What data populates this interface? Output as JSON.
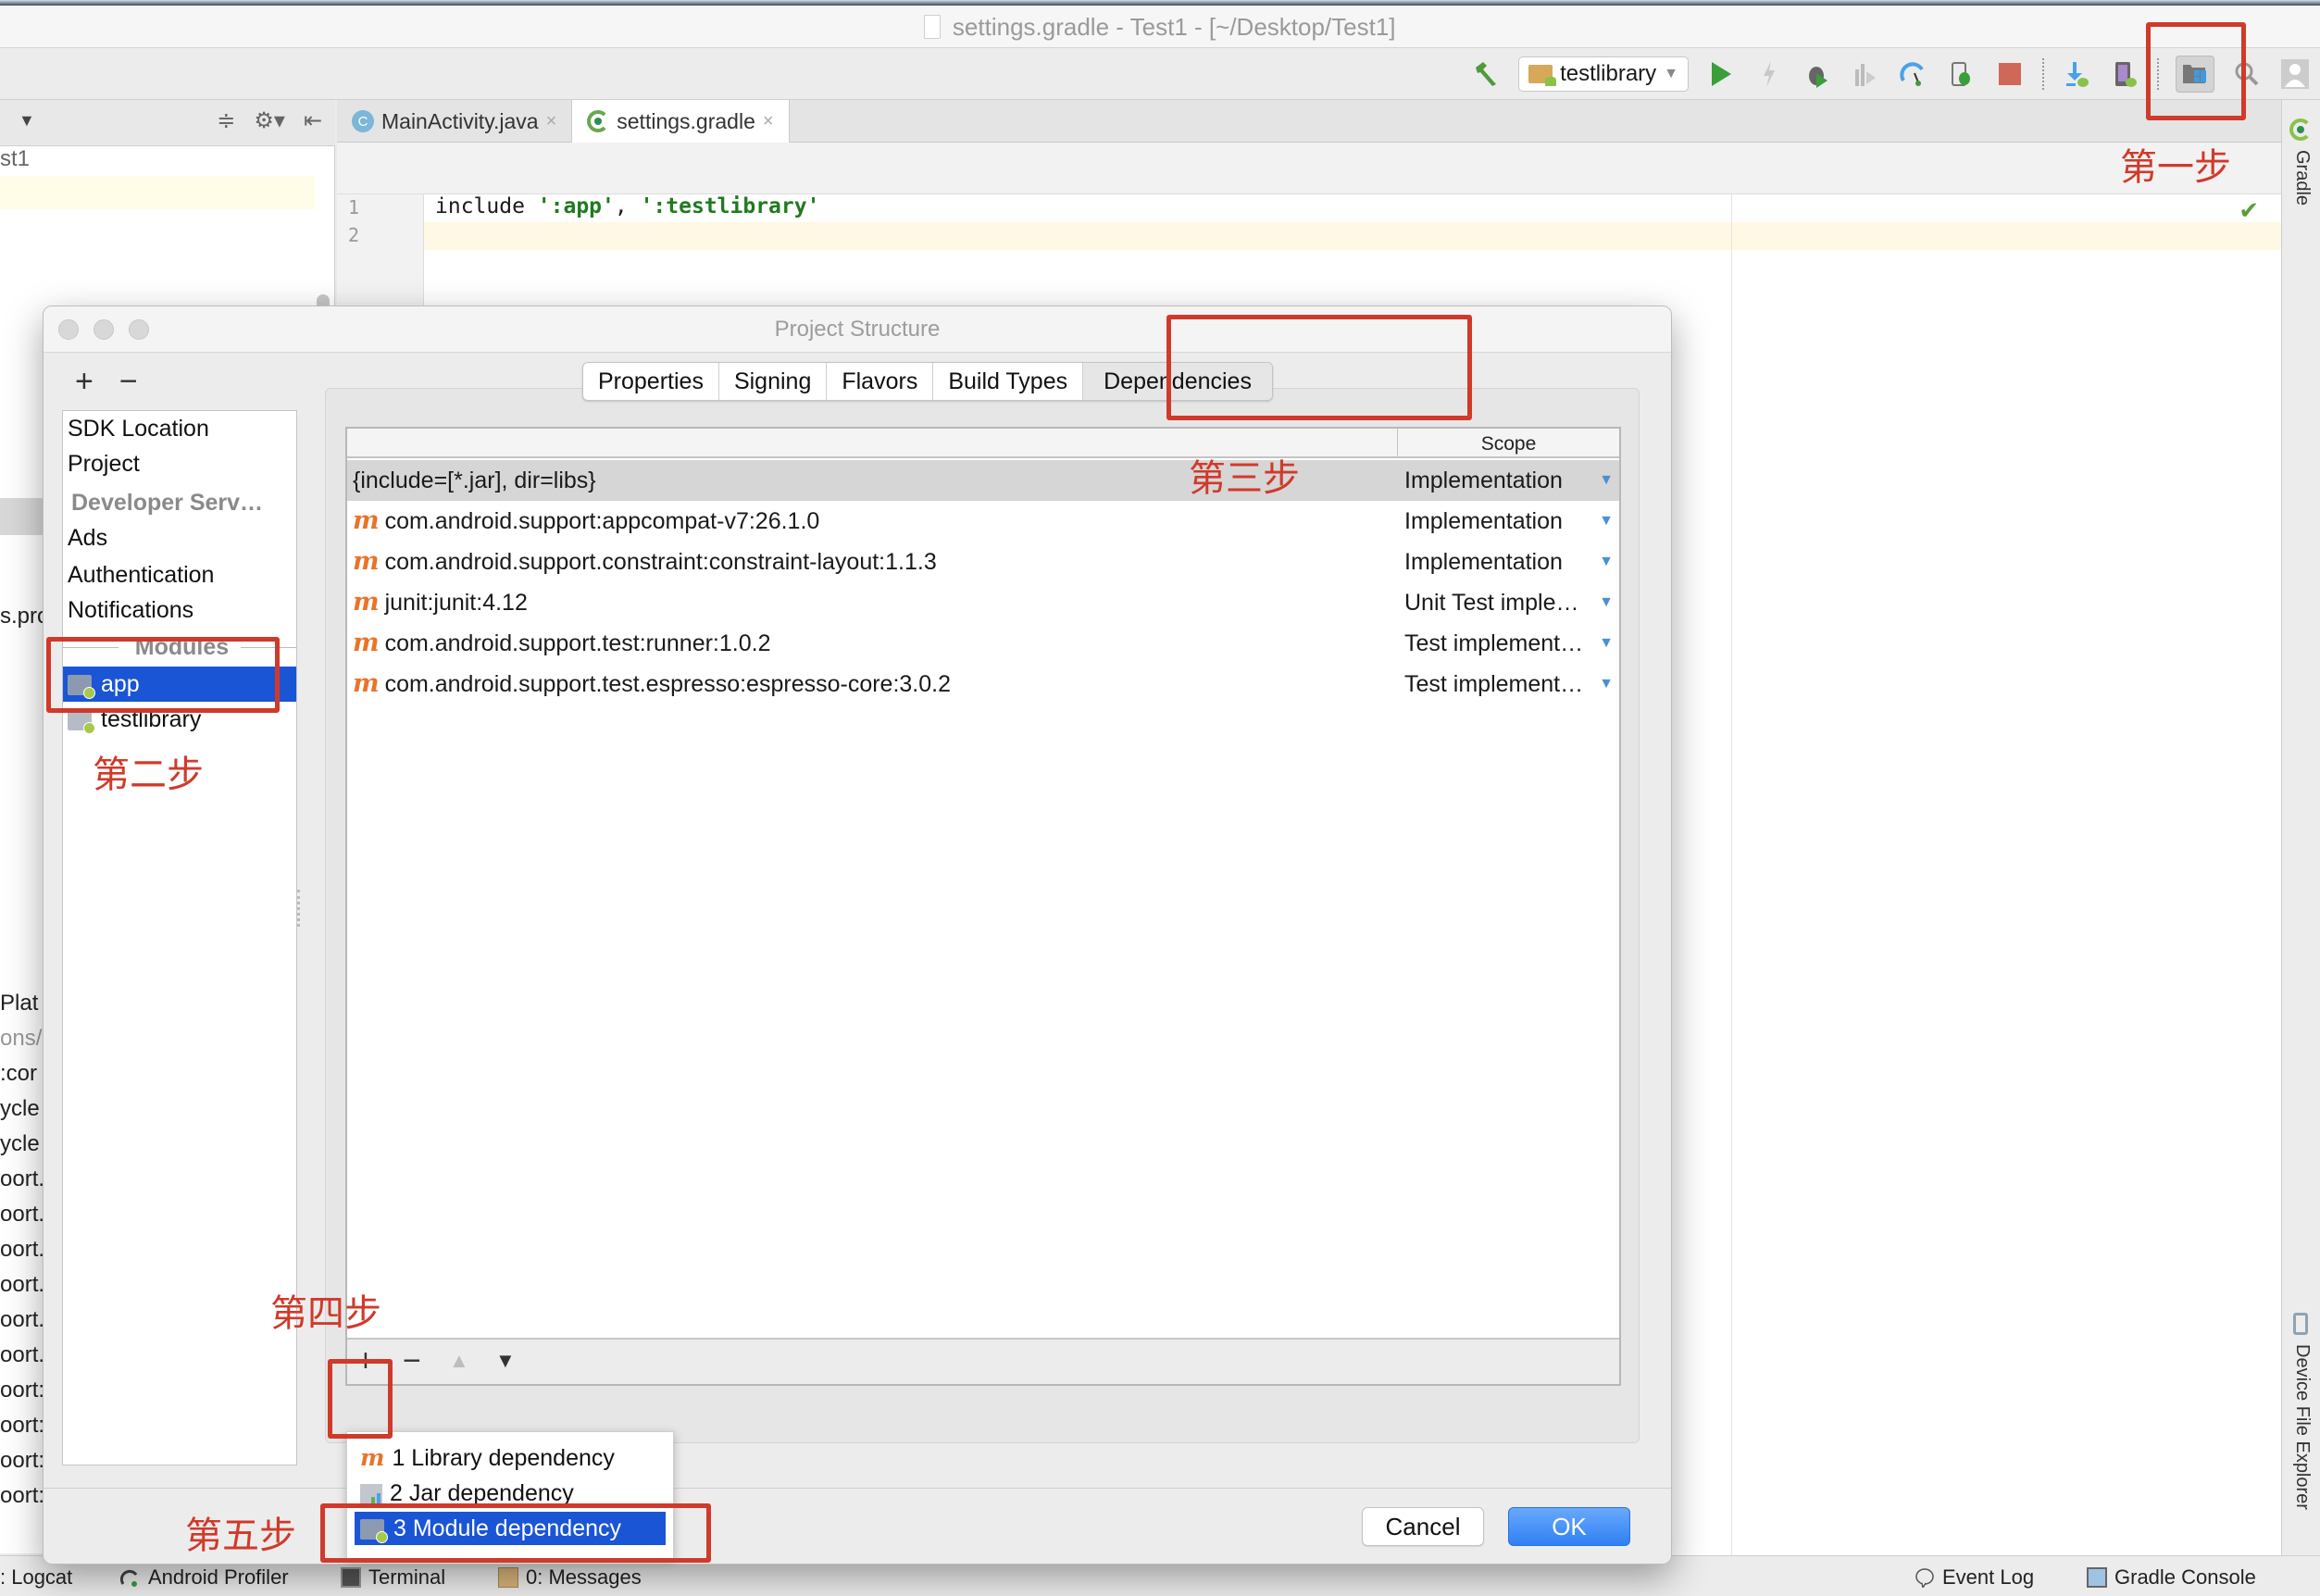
{
  "window": {
    "title": "settings.gradle - Test1 - [~/Desktop/Test1]"
  },
  "toolbar": {
    "run_config": "testlibrary",
    "icons": [
      "build-hammer-icon",
      "run-icon",
      "apply-changes-icon",
      "debug-icon",
      "coverage-icon",
      "profile-icon",
      "attach-debugger-icon",
      "stop-icon",
      "sdk-manager-icon",
      "avd-manager-icon",
      "project-structure-icon",
      "search-icon",
      "user-icon"
    ]
  },
  "project_panel": {
    "rows": [
      "st1",
      "s.pro",
      "Plat",
      "ons/",
      ":cor",
      "ycle",
      "ycle",
      "oort.",
      "oort.",
      "oort.",
      "oort.",
      "oort.",
      "oort.",
      "oort:",
      "oort:",
      "oort:",
      "oort:"
    ]
  },
  "editor": {
    "tabs": [
      {
        "label": "MainActivity.java",
        "icon": "java-class-icon",
        "active": false
      },
      {
        "label": "settings.gradle",
        "icon": "gradle-icon",
        "active": true
      }
    ],
    "lines": [
      {
        "number": "1",
        "keyword": "include ",
        "str1": "':app'",
        "sep": ", ",
        "str2": "':testlibrary'"
      },
      {
        "number": "2"
      }
    ]
  },
  "right_strip": {
    "gradle": "Gradle",
    "device_explorer": "Device File Explorer"
  },
  "dialog": {
    "title": "Project Structure",
    "add_label": "+",
    "remove_label": "−",
    "sidebar": {
      "items": [
        {
          "label": "SDK Location",
          "type": "item"
        },
        {
          "label": "Project",
          "type": "item"
        },
        {
          "label": "Developer Serv…",
          "type": "section"
        },
        {
          "label": "Ads",
          "type": "item"
        },
        {
          "label": "Authentication",
          "type": "item"
        },
        {
          "label": "Notifications",
          "type": "item"
        },
        {
          "label": "Modules",
          "type": "divider"
        },
        {
          "label": "app",
          "type": "module",
          "selected": true
        },
        {
          "label": "testlibrary",
          "type": "module",
          "selected": false
        }
      ]
    },
    "tabs": [
      {
        "label": "Properties"
      },
      {
        "label": "Signing"
      },
      {
        "label": "Flavors"
      },
      {
        "label": "Build Types"
      },
      {
        "label": "Dependencies",
        "active": true
      }
    ],
    "table": {
      "columns": [
        "",
        "Scope"
      ],
      "rows": [
        {
          "name": "{include=[*.jar], dir=libs}",
          "maven": false,
          "scope": "Implementation",
          "selected": true
        },
        {
          "name": "com.android.support:appcompat-v7:26.1.0",
          "maven": true,
          "scope": "Implementation"
        },
        {
          "name": "com.android.support.constraint:constraint-layout:1.1.3",
          "maven": true,
          "scope": "Implementation"
        },
        {
          "name": "junit:junit:4.12",
          "maven": true,
          "scope": "Unit Test imple…"
        },
        {
          "name": "com.android.support.test:runner:1.0.2",
          "maven": true,
          "scope": "Test implement…"
        },
        {
          "name": "com.android.support.test.espresso:espresso-core:3.0.2",
          "maven": true,
          "scope": "Test implement…"
        }
      ],
      "toolbar": {
        "add": "+",
        "remove": "−",
        "up": "▲",
        "down": "▼"
      }
    },
    "add_menu": [
      {
        "label": "1  Library dependency",
        "icon": "maven-icon"
      },
      {
        "label": "2  Jar dependency",
        "icon": "jar-icon"
      },
      {
        "label": "3  Module dependency",
        "icon": "module-icon",
        "selected": true
      }
    ],
    "cancel_label": "Cancel",
    "ok_label": "OK"
  },
  "statusbar": {
    "items": [
      {
        "label": ": Logcat"
      },
      {
        "label": "Android Profiler"
      },
      {
        "label": "Terminal"
      },
      {
        "label": "0: Messages"
      },
      {
        "label": "Event Log"
      },
      {
        "label": "Gradle Console"
      }
    ]
  },
  "annotations": {
    "step1": "第一步",
    "step2": "第二步",
    "step3": "第三步",
    "step4": "第四步",
    "step5": "第五步",
    "color": "#d03a2a"
  },
  "colors": {
    "selection": "#1a55d6",
    "maven": "#e8742a",
    "ok_button": "#2f80f4",
    "string_literal": "#1f7a1f"
  }
}
